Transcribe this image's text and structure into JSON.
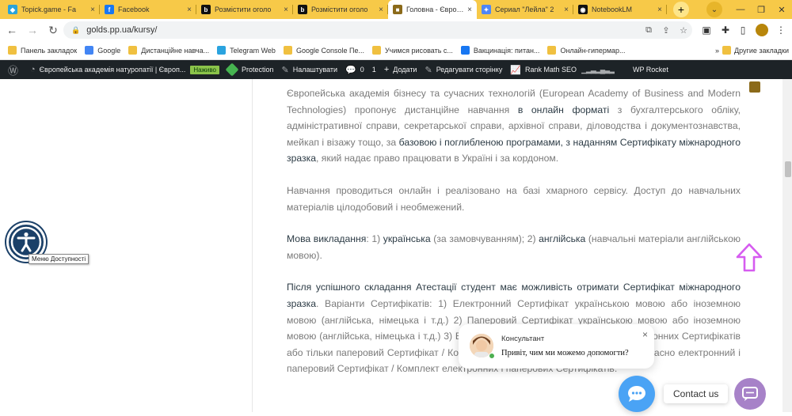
{
  "tabs": [
    {
      "title": "Topick.game - Fa",
      "favicon_color": "#29a3d8",
      "glyph": "◆",
      "active": false
    },
    {
      "title": "Facebook",
      "favicon_color": "#1877f2",
      "glyph": "f",
      "active": false
    },
    {
      "title": "Розмістити оголо",
      "favicon_color": "#111111",
      "glyph": "b",
      "active": false
    },
    {
      "title": "Розмістити оголо",
      "favicon_color": "#111111",
      "glyph": "b",
      "active": false
    },
    {
      "title": "Головна - Європе",
      "favicon_color": "#8b6a1a",
      "glyph": "■",
      "active": true
    },
    {
      "title": "Сериал \"Лейла\" 2",
      "favicon_color": "#4f86f7",
      "glyph": "✦",
      "active": false
    },
    {
      "title": "NotebookLM",
      "favicon_color": "#111111",
      "glyph": "◉",
      "active": false
    }
  ],
  "tab_close_glyph": "×",
  "new_tab_glyph": "+",
  "address": {
    "url": "golds.pp.ua/kursy/"
  },
  "bookmarks": [
    {
      "label": "Панель закладок",
      "icon": "folder",
      "color": "#f0c040"
    },
    {
      "label": "Google",
      "icon": "google-icon",
      "color": "#4285f4"
    },
    {
      "label": "Дистанційне навча...",
      "icon": "folder",
      "color": "#f0c040"
    },
    {
      "label": "Telegram Web",
      "icon": "telegram-icon",
      "color": "#2aa3df"
    },
    {
      "label": "Google Console Пе...",
      "icon": "folder",
      "color": "#f0c040"
    },
    {
      "label": "Учимся рисовать с...",
      "icon": "folder",
      "color": "#f0c040"
    },
    {
      "label": "Вакцинація: питан...",
      "icon": "facebook-icon",
      "color": "#1877f2"
    },
    {
      "label": "Онлайн-гипермар...",
      "icon": "folder",
      "color": "#f0c040"
    }
  ],
  "bookmarks_more": "»",
  "other_bookmarks": "Другие закладки",
  "wp": {
    "site": "Європейська академія натуропатії | Європ...",
    "live": "Наживо",
    "protection": "Protection",
    "customize": "Налаштувати",
    "comments": "0",
    "updates": "1",
    "add": "Додати",
    "edit": "Редагувати сторінку",
    "rankmath": "Rank Math SEO",
    "wprocket": "WP Rocket"
  },
  "article": {
    "p1": [
      "Європейська академія бізнесу та сучасних технологій (European Academy of Business and Modern Technologies) пропонує дистанційне навчання ",
      "в онлайн форматі",
      " з бухгалтерського обліку, адміністративної справи, секретарської справи, архівної справи, діловодства і документознавства, мейкап і візажу тощо, за ",
      "базовою і поглибленою програмами, з наданням Сертифікату міжнародного зразка",
      ", який надає право працювати в Україні і за кордоном."
    ],
    "p2": "Навчання проводиться онлайн і реалізовано на базі хмарного сервісу. Доступ до навчальних матеріалів цілодобовий і необмежений.",
    "p3": [
      "Мова викладання",
      ": 1) ",
      "українська",
      " (за замовчуванням); 2) ",
      "англійська",
      " (навчальні матеріали англійською мовою)."
    ],
    "p4": [
      "Після успішного складання Атестації студент має можливість отримати Сертифікат міжнародного зразка",
      ". Варіанти Сертифікатів: 1) Електронний Сертифікат українською мовою або іноземною мовою (англійська, німецька і т.д.) 2) Паперовий Сертифікат українською мовою або іноземною мовою (англійська, німецька і т.д.) 3) Електронний Сертифікат / Комплект електронних Сертифікатів або тільки паперовий Сертифікат / Комплект паперових Сертифікатів, або одночасно електронний і паперовий Сертифікат / Комплект електронних і паперових Сертифікатів."
    ]
  },
  "accessibility_tooltip": "Меню Доступності",
  "chat": {
    "name": "Консультант",
    "message": "Привіт, чим ми можемо допомогти?",
    "close": "×"
  },
  "contact_label": "Contact us",
  "colors": {
    "tabbar": "#f7c948",
    "wp_bar": "#1d2327",
    "accessibility": "#1b4068",
    "scroll_arrow": "#d65cf0",
    "chat_button": "#4aa3f5",
    "message_button": "#a782c8"
  }
}
